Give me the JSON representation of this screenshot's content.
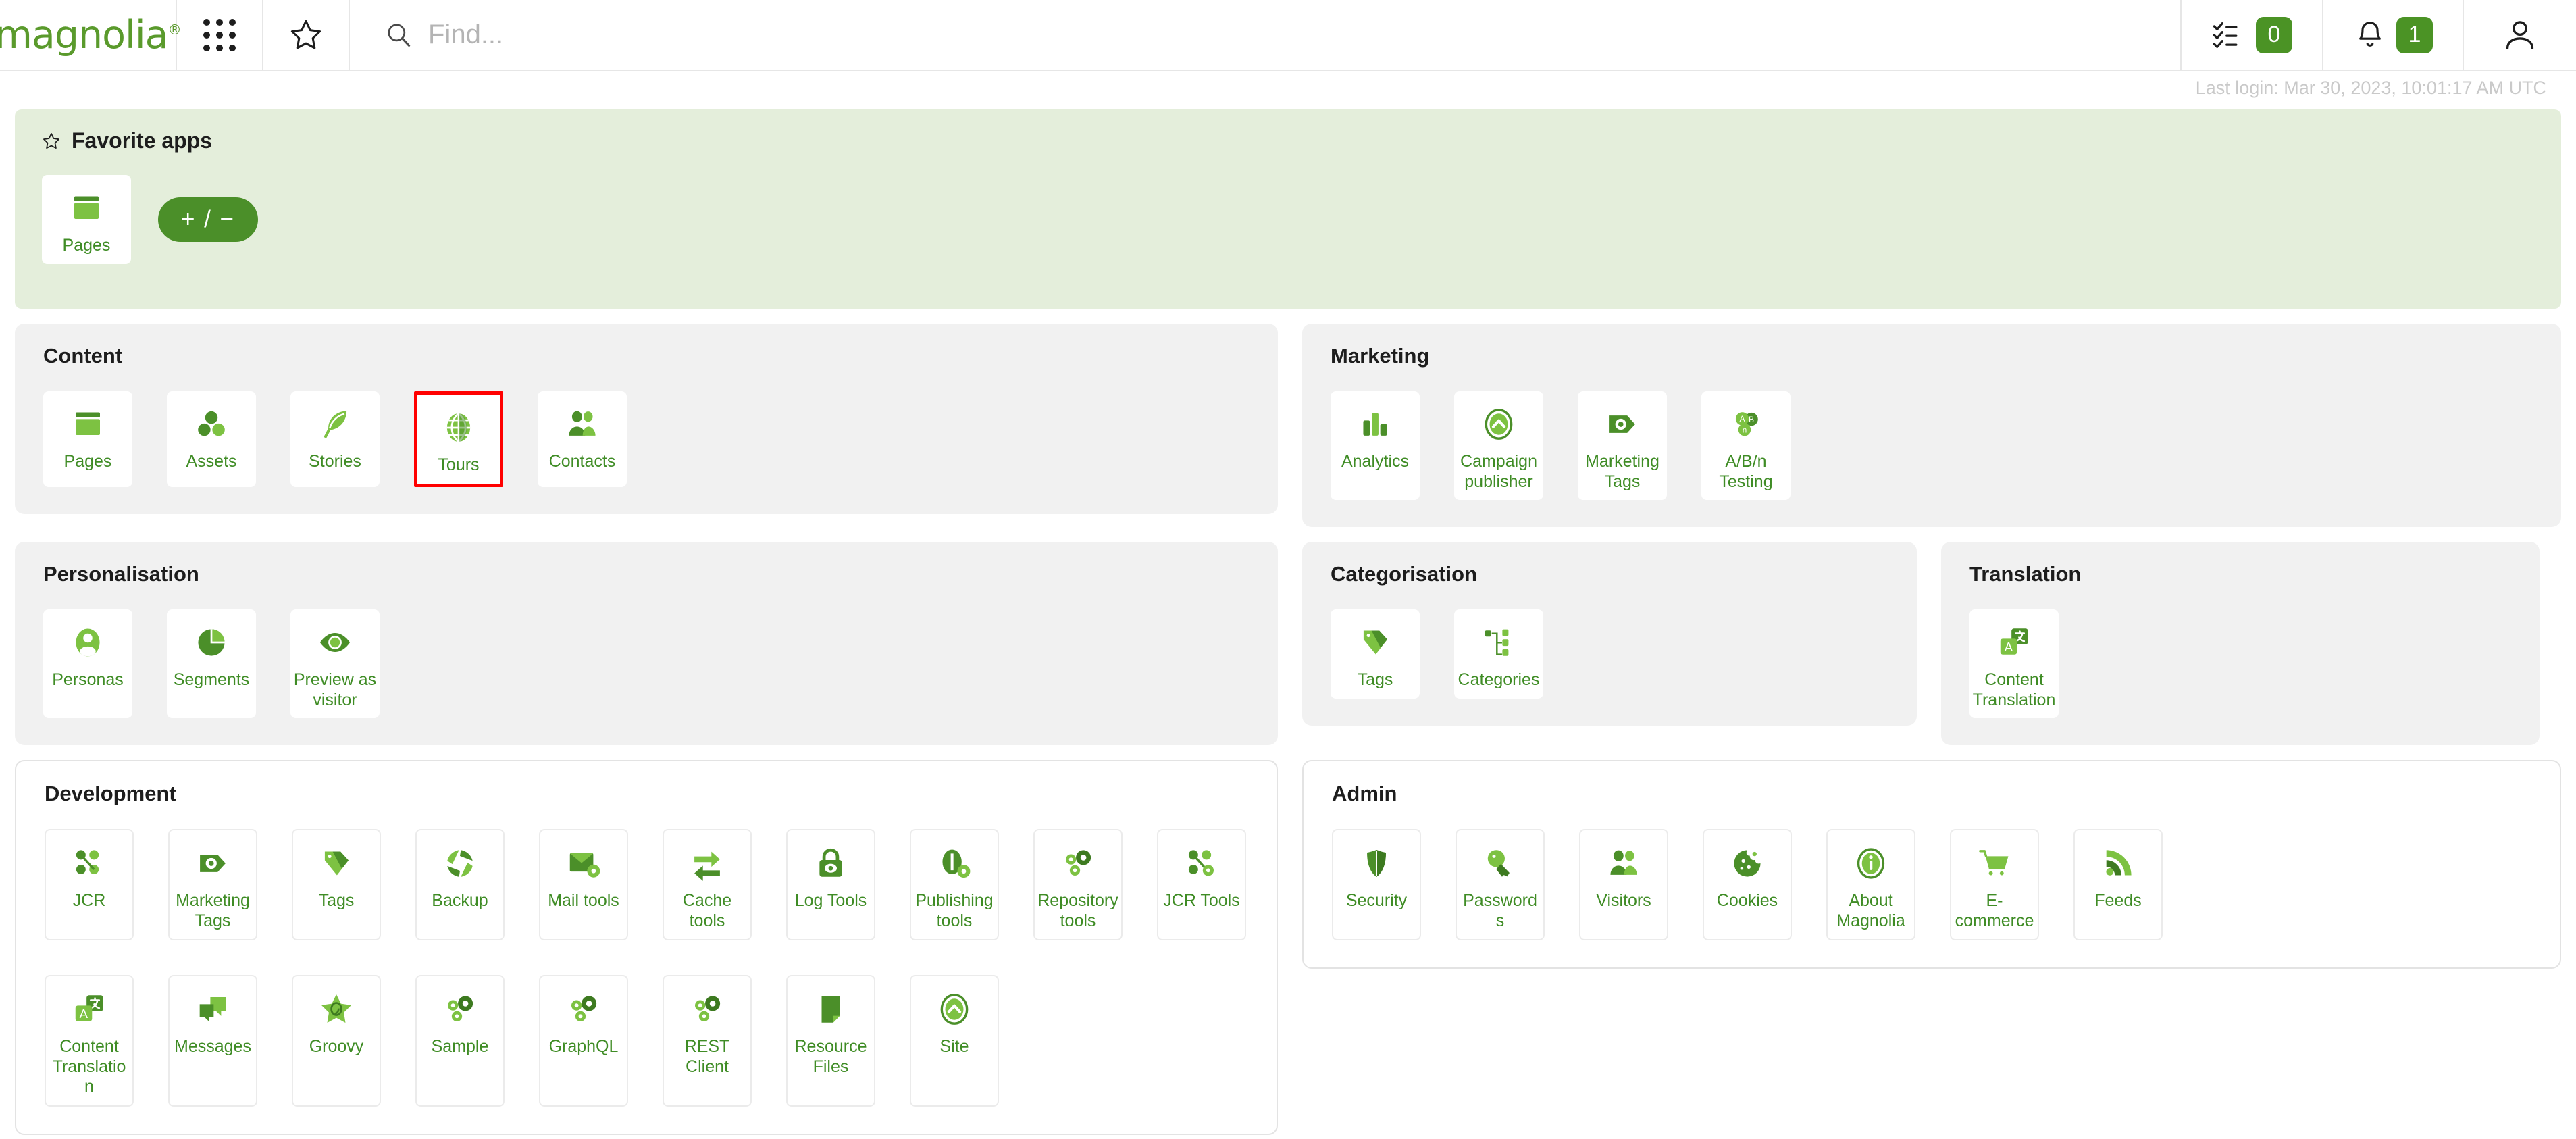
{
  "colors": {
    "brand_green": "#5a9a2c",
    "accent_green": "#4b9325",
    "label_green": "#3f8c25",
    "highlight_red": "#ff0000",
    "panel_gray": "#f1f1f1",
    "favorites_bg": "#e4eedb"
  },
  "header": {
    "logo_text": "magnolia",
    "logo_mark": "®",
    "apps_grid_icon": "grid-apps-icon",
    "favorites_star_icon": "star-icon",
    "search_icon": "search-icon",
    "search_placeholder": "Find...",
    "search_value": "",
    "tasks_icon": "tasks-checklist-icon",
    "tasks_count": "0",
    "notifications_icon": "bell-icon",
    "notifications_count": "1",
    "user_icon": "user-avatar-icon"
  },
  "last_login": "Last login: Mar 30, 2023, 10:01:17 AM UTC",
  "favorites": {
    "star_icon": "star-icon",
    "title": "Favorite apps",
    "edit_label": "+ / −",
    "apps": [
      {
        "label": "Pages",
        "icon": "pages-icon"
      }
    ]
  },
  "sections": [
    {
      "title": "Content",
      "style": "gray",
      "apps": [
        {
          "label": "Pages",
          "icon": "pages-icon",
          "highlighted": false
        },
        {
          "label": "Assets",
          "icon": "assets-icon",
          "highlighted": false
        },
        {
          "label": "Stories",
          "icon": "stories-feather-icon",
          "highlighted": false
        },
        {
          "label": "Tours",
          "icon": "tours-globe-icon",
          "highlighted": true
        },
        {
          "label": "Contacts",
          "icon": "contacts-people-icon",
          "highlighted": false
        }
      ]
    },
    {
      "title": "Marketing",
      "style": "gray",
      "apps": [
        {
          "label": "Analytics",
          "icon": "analytics-bars-icon",
          "highlighted": false
        },
        {
          "label": "Campaign publisher",
          "icon": "campaign-publisher-icon",
          "highlighted": false
        },
        {
          "label": "Marketing Tags",
          "icon": "marketing-tags-icon",
          "highlighted": false
        },
        {
          "label": "A/B/n Testing",
          "icon": "abn-testing-icon",
          "highlighted": false
        }
      ]
    },
    {
      "title": "Personalisation",
      "style": "gray",
      "apps": [
        {
          "label": "Personas",
          "icon": "personas-icon",
          "highlighted": false
        },
        {
          "label": "Segments",
          "icon": "segments-pie-icon",
          "highlighted": false
        },
        {
          "label": "Preview as visitor",
          "icon": "preview-eye-icon",
          "highlighted": false
        }
      ]
    },
    {
      "title": "Categorisation",
      "style": "gray",
      "apps": [
        {
          "label": "Tags",
          "icon": "tag-icon",
          "highlighted": false
        },
        {
          "label": "Categories",
          "icon": "categories-tree-icon",
          "highlighted": false
        }
      ]
    },
    {
      "title": "Translation",
      "style": "gray",
      "apps": [
        {
          "label": "Content Translation",
          "icon": "translation-icon",
          "highlighted": false
        }
      ]
    },
    {
      "title": "Development",
      "style": "bordered",
      "apps": [
        {
          "label": "JCR",
          "icon": "jcr-nodes-icon",
          "highlighted": false
        },
        {
          "label": "Marketing Tags",
          "icon": "marketing-tags-icon",
          "highlighted": false
        },
        {
          "label": "Tags",
          "icon": "tag-icon",
          "highlighted": false
        },
        {
          "label": "Backup",
          "icon": "backup-icon",
          "highlighted": false
        },
        {
          "label": "Mail tools",
          "icon": "mail-tools-icon",
          "highlighted": false
        },
        {
          "label": "Cache tools",
          "icon": "cache-tools-icon",
          "highlighted": false
        },
        {
          "label": "Log Tools",
          "icon": "log-tools-lock-icon",
          "highlighted": false
        },
        {
          "label": "Publishing tools",
          "icon": "publishing-tools-icon",
          "highlighted": false
        },
        {
          "label": "Repository tools",
          "icon": "gears-icon",
          "highlighted": false
        },
        {
          "label": "JCR Tools",
          "icon": "jcr-tools-icon",
          "highlighted": false
        },
        {
          "label": "Content Translation",
          "icon": "translation-icon",
          "highlighted": false
        },
        {
          "label": "Messages",
          "icon": "messages-icon",
          "highlighted": false
        },
        {
          "label": "Groovy",
          "icon": "groovy-star-icon",
          "highlighted": false
        },
        {
          "label": "Sample",
          "icon": "gears-icon",
          "highlighted": false
        },
        {
          "label": "GraphQL",
          "icon": "gears-icon",
          "highlighted": false
        },
        {
          "label": "REST Client",
          "icon": "gears-icon",
          "highlighted": false
        },
        {
          "label": "Resource Files",
          "icon": "resource-files-icon",
          "highlighted": false
        },
        {
          "label": "Site",
          "icon": "site-icon",
          "highlighted": false
        }
      ]
    },
    {
      "title": "Admin",
      "style": "bordered",
      "apps": [
        {
          "label": "Security",
          "icon": "security-shield-icon",
          "highlighted": false
        },
        {
          "label": "Passwords",
          "icon": "passwords-key-icon",
          "highlighted": false
        },
        {
          "label": "Visitors",
          "icon": "visitors-icon",
          "highlighted": false
        },
        {
          "label": "Cookies",
          "icon": "cookies-icon",
          "highlighted": false
        },
        {
          "label": "About Magnolia",
          "icon": "about-info-icon",
          "highlighted": false
        },
        {
          "label": "E-commerce",
          "icon": "ecommerce-cart-icon",
          "highlighted": false
        },
        {
          "label": "Feeds",
          "icon": "feeds-rss-icon",
          "highlighted": false
        }
      ]
    }
  ]
}
